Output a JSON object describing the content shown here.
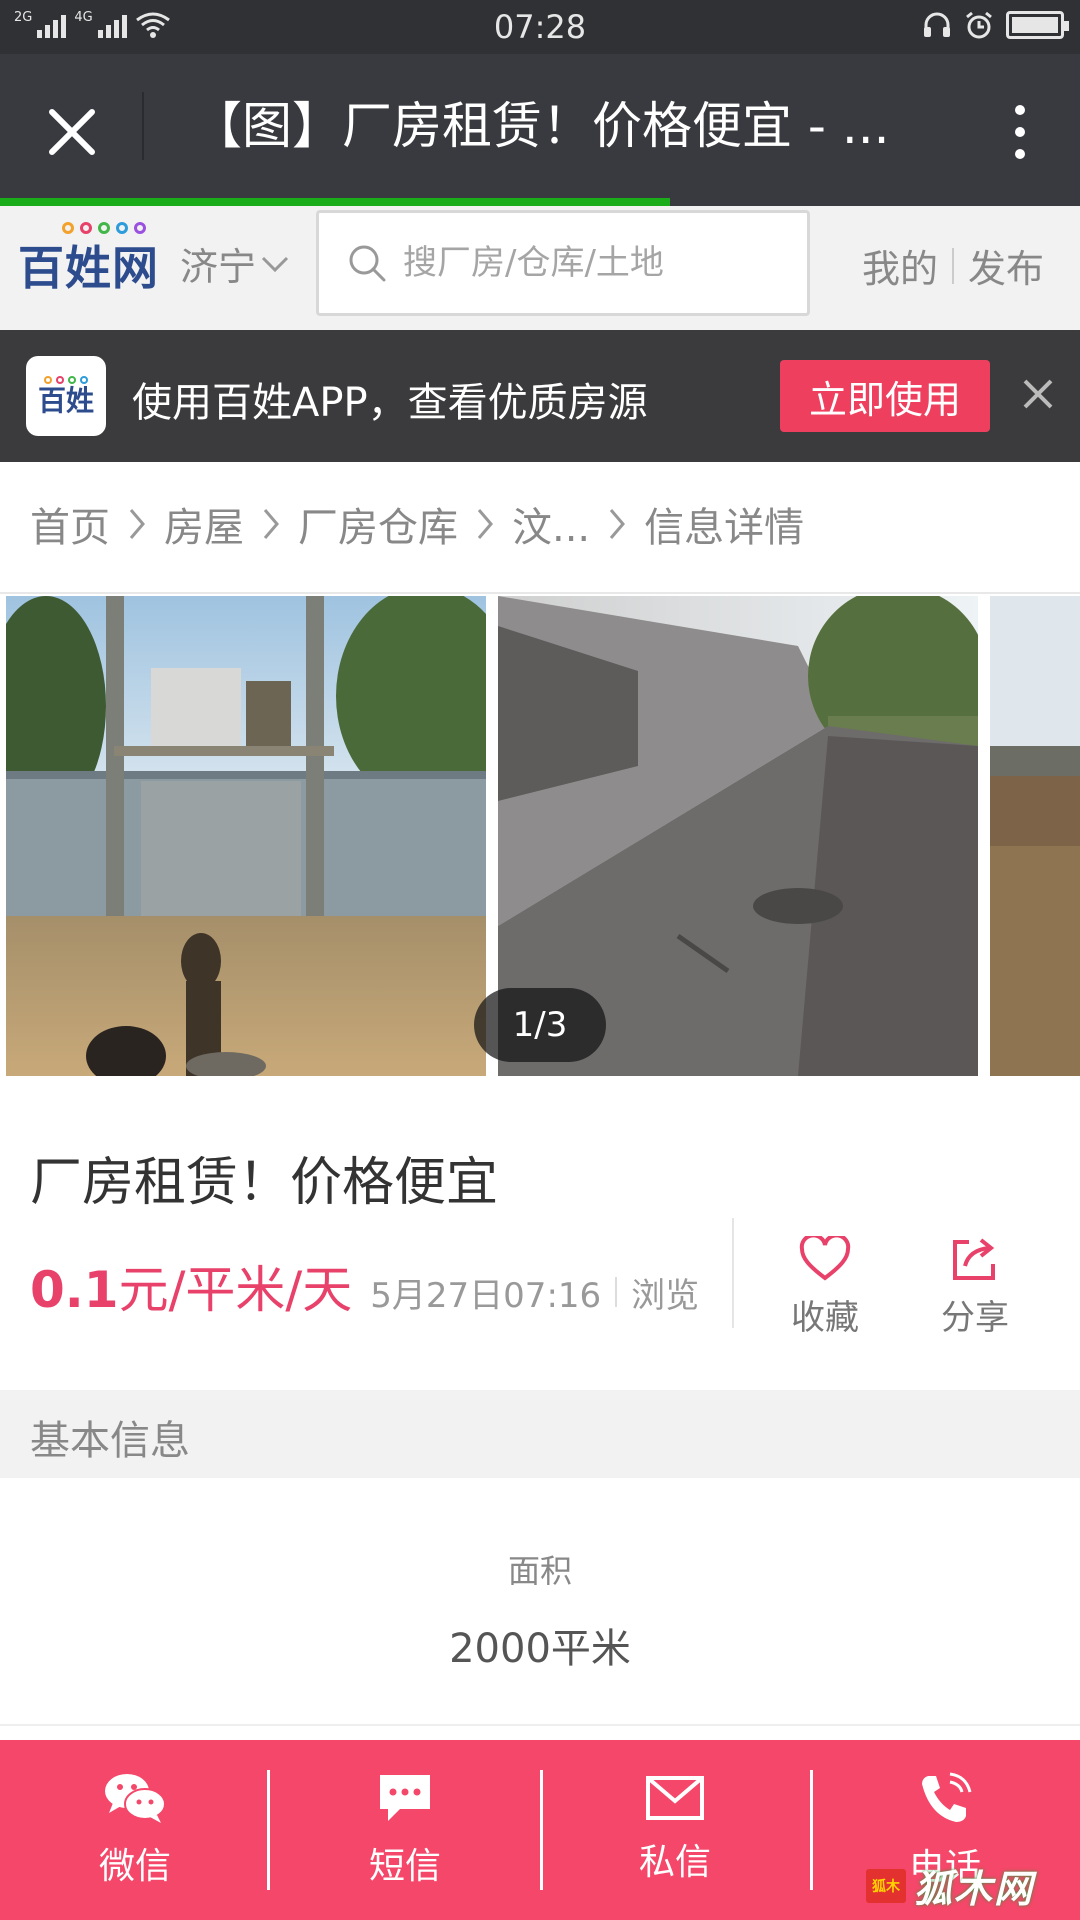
{
  "status_bar": {
    "time": "07:28",
    "signal1_label": "2G",
    "signal2_label": "4G"
  },
  "title_bar": {
    "title": "【图】厂房租赁！价格便宜 - ..."
  },
  "header": {
    "brand": "百姓网",
    "city": "济宁",
    "search_placeholder": "搜厂房/仓库/土地",
    "my_label": "我的",
    "publish_label": "发布"
  },
  "app_banner": {
    "icon_text": "百姓",
    "text": "使用百姓APP，查看优质房源",
    "button_label": "立即使用"
  },
  "breadcrumb": [
    "首页",
    "房屋",
    "厂房仓库",
    "汶...",
    "信息详情"
  ],
  "gallery": {
    "counter": "1/3"
  },
  "listing": {
    "title": "厂房租赁！价格便宜",
    "price_number": "0.1",
    "price_unit": "元/平米/天",
    "date": "5月27日07:16",
    "views_label": "浏览",
    "favorite_label": "收藏",
    "share_label": "分享"
  },
  "basic_info": {
    "section_title": "基本信息",
    "area_label": "面积",
    "area_value": "2000平米"
  },
  "bottom_bar": {
    "wechat_label": "微信",
    "sms_label": "短信",
    "message_label": "私信",
    "call_label": "电话"
  },
  "watermark": {
    "badge_text": "狐木",
    "text": "狐木网"
  },
  "colors": {
    "accent_pink": "#f44769",
    "price_red": "#e8416a",
    "brand_blue": "#2d4c8e",
    "progress_green": "#1aad19"
  }
}
